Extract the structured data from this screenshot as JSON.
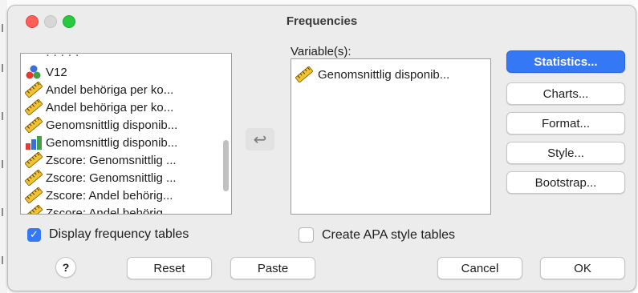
{
  "window": {
    "title": "Frequencies"
  },
  "source_list": {
    "items": [
      {
        "label": "V12",
        "icon": "nominal-icon"
      },
      {
        "label": "Andel behöriga per ko...",
        "icon": "scale-ruler-icon"
      },
      {
        "label": "Andel behöriga per ko...",
        "icon": "scale-ruler-icon"
      },
      {
        "label": "Genomsnittlig disponib...",
        "icon": "scale-ruler-icon"
      },
      {
        "label": "Genomsnittlig disponib...",
        "icon": "ordinal-bar-icon"
      },
      {
        "label": "Zscore:  Genomsnittlig ...",
        "icon": "scale-ruler-icon"
      },
      {
        "label": "Zscore:  Genomsnittlig ...",
        "icon": "scale-ruler-icon"
      },
      {
        "label": "Zscore:  Andel behörig...",
        "icon": "scale-ruler-icon"
      },
      {
        "label": "Zscore:  Andel behörig...",
        "icon": "scale-ruler-icon"
      }
    ]
  },
  "move_button": {
    "icon": "return-arrow-icon",
    "glyph": "↩"
  },
  "variables": {
    "label": "Variable(s):",
    "items": [
      {
        "label": "Genomsnittlig disponib...",
        "icon": "scale-ruler-icon"
      }
    ]
  },
  "side_buttons": {
    "statistics": "Statistics...",
    "charts": "Charts...",
    "format": "Format...",
    "style": "Style...",
    "bootstrap": "Bootstrap..."
  },
  "options": {
    "display_frequency_tables": {
      "label": "Display frequency tables",
      "checked": true
    },
    "create_apa_style_tables": {
      "label": "Create APA style tables",
      "checked": false
    }
  },
  "bottom_buttons": {
    "help": "?",
    "reset": "Reset",
    "paste": "Paste",
    "cancel": "Cancel",
    "ok": "OK"
  },
  "colors": {
    "accent": "#3478f6",
    "close": "#ff5f57",
    "zoom": "#28c840"
  }
}
